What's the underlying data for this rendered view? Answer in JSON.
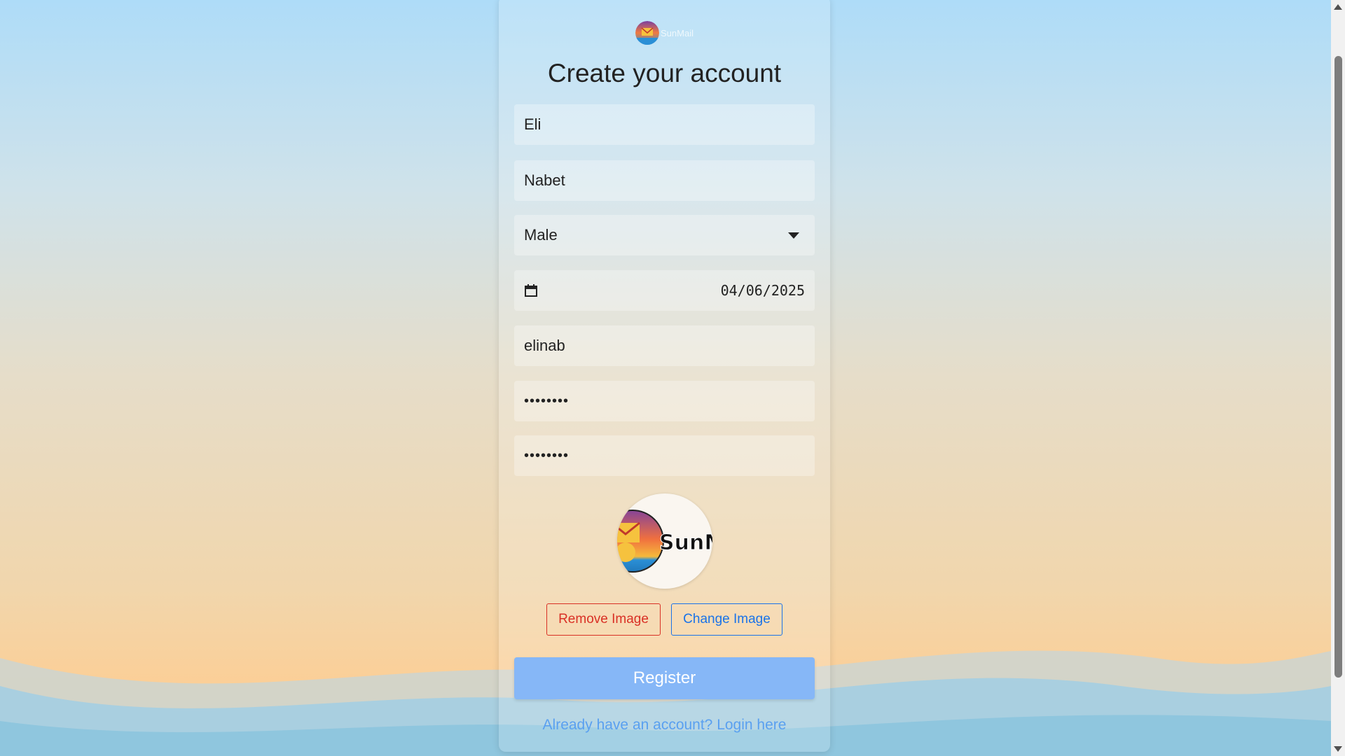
{
  "brand": {
    "name": "SunMail"
  },
  "form": {
    "title": "Create your account",
    "first_name": "Eli",
    "last_name": "Nabet",
    "gender": "Male",
    "birth_date": "04/06/2025",
    "username": "elinab",
    "password": "••••••••",
    "confirm_password": "••••••••"
  },
  "image_actions": {
    "remove_label": "Remove Image",
    "change_label": "Change Image"
  },
  "register_label": "Register",
  "login_link": "Already have an account? Login here",
  "colors": {
    "register": "#86b7f7",
    "remove": "#d93025",
    "change": "#1a73e8",
    "link": "#5aa0f0"
  },
  "icons": {
    "calendar": "calendar-icon",
    "dropdown": "chevron-down-icon"
  }
}
